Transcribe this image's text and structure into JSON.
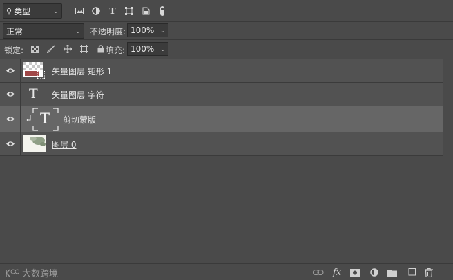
{
  "filter": {
    "label": "类型"
  },
  "blend": {
    "mode": "正常",
    "opacity_label": "不透明度:",
    "opacity": "100%"
  },
  "lock": {
    "label": "锁定:",
    "fill_label": "填充:",
    "fill": "100%"
  },
  "layers": [
    {
      "name": "矢量图层 矩形 1",
      "kind": "shape"
    },
    {
      "name": "矢量图层 字符",
      "kind": "text"
    },
    {
      "name": "剪切蒙版",
      "kind": "text-clipped",
      "selected": true
    },
    {
      "name": "图层 0",
      "kind": "image"
    }
  ],
  "brand": {
    "text": "大数跨境"
  },
  "icons": {
    "filter": [
      "image-filter-icon",
      "adjustment-filter-icon",
      "type-filter-icon",
      "shape-filter-icon",
      "smart-object-filter-icon",
      "filter-toggle-icon"
    ],
    "lock": [
      "lock-pixels-icon",
      "lock-image-icon",
      "lock-position-icon",
      "lock-artboard-icon",
      "lock-all-icon"
    ],
    "footer": [
      "link-icon",
      "fx-icon",
      "mask-icon",
      "adjustment-icon",
      "folder-icon",
      "new-layer-icon",
      "trash-icon"
    ]
  }
}
